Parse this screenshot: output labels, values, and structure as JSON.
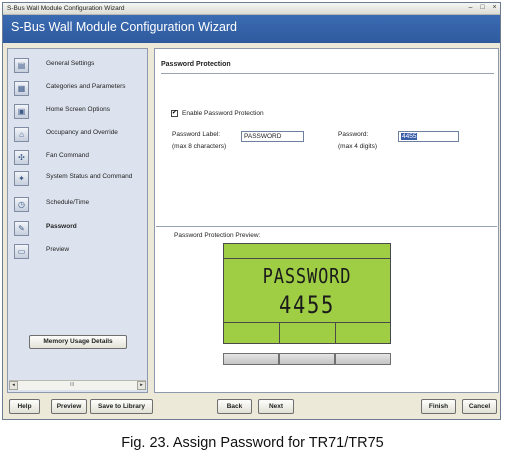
{
  "window": {
    "title": "S-Bus Wall Module Configuration Wizard",
    "heading": "S-Bus Wall Module Configuration Wizard",
    "minimize_glyph": "–",
    "maximize_glyph": "□",
    "close_glyph": "×"
  },
  "sidebar": {
    "items": [
      {
        "label": "General Settings",
        "icon": "settings-icon"
      },
      {
        "label": "Categories and Parameters",
        "icon": "categories-icon"
      },
      {
        "label": "Home Screen Options",
        "icon": "home-screen-icon"
      },
      {
        "label": "Occupancy and Override",
        "icon": "house-icon"
      },
      {
        "label": "Fan Command",
        "icon": "fan-icon"
      },
      {
        "label": "System Status and Command",
        "icon": "system-status-icon"
      },
      {
        "label": "Schedule/Time",
        "icon": "schedule-icon"
      },
      {
        "label": "Password",
        "icon": "password-icon"
      },
      {
        "label": "Preview",
        "icon": "preview-icon"
      }
    ],
    "memory_button": "Memory Usage Details",
    "scroll_left": "◂",
    "scroll_right": "▸",
    "scroll_grip": "III"
  },
  "main": {
    "section_title": "Password Protection",
    "enable_label": "Enable Password Protection",
    "enable_checked": true,
    "check_mark": "✔",
    "password_label_caption": "Password Label:",
    "password_label_hint": "(max 8 characters)",
    "password_label_value": "PASSWORD",
    "password_caption": "Password:",
    "password_hint": "(max 4 digits)",
    "password_value": "4455",
    "preview_caption": "Password Protection Preview:",
    "lcd_line1": "PASSWORD",
    "lcd_line2": "4455",
    "lcd_color": "#9fce45"
  },
  "footer": {
    "help": "Help",
    "preview": "Preview",
    "save": "Save to Library",
    "back": "Back",
    "next": "Next",
    "finish": "Finish",
    "cancel": "Cancel"
  },
  "caption": "Fig. 23. Assign Password for TR71/TR75"
}
